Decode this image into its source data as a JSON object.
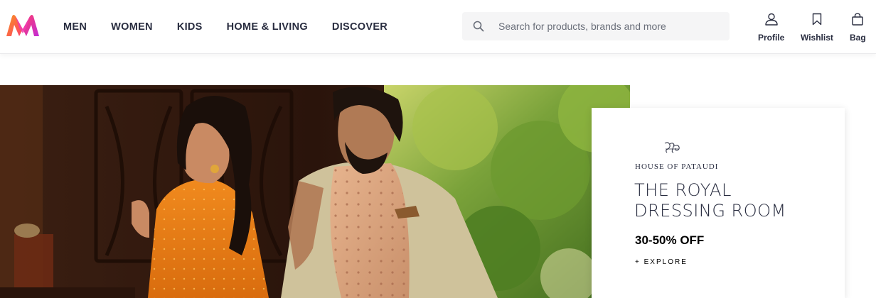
{
  "brand_colors": {
    "logo_pink": "#ff3f6c",
    "logo_orange": "#f7931e",
    "logo_purple": "#c22bd6",
    "text_dark": "#282c3f"
  },
  "header": {
    "logo_icon": "myntra-logo",
    "nav": [
      {
        "label": "MEN"
      },
      {
        "label": "WOMEN"
      },
      {
        "label": "KIDS"
      },
      {
        "label": "HOME & LIVING"
      },
      {
        "label": "DISCOVER"
      }
    ],
    "search": {
      "icon": "search-icon",
      "placeholder": "Search for products, brands and more",
      "value": ""
    },
    "actions": [
      {
        "icon": "profile-icon",
        "label": "Profile"
      },
      {
        "icon": "bookmark-icon",
        "label": "Wishlist"
      },
      {
        "icon": "bag-icon",
        "label": "Bag"
      }
    ]
  },
  "banner": {
    "promo": {
      "brand_icon": "house-of-pataudi-monogram",
      "brand": "HOUSE OF PATAUDI",
      "headline_line1": "THE ROYAL",
      "headline_line2": "DRESSING ROOM",
      "offer": "30-50% OFF",
      "cta": "+ EXPLORE"
    }
  }
}
